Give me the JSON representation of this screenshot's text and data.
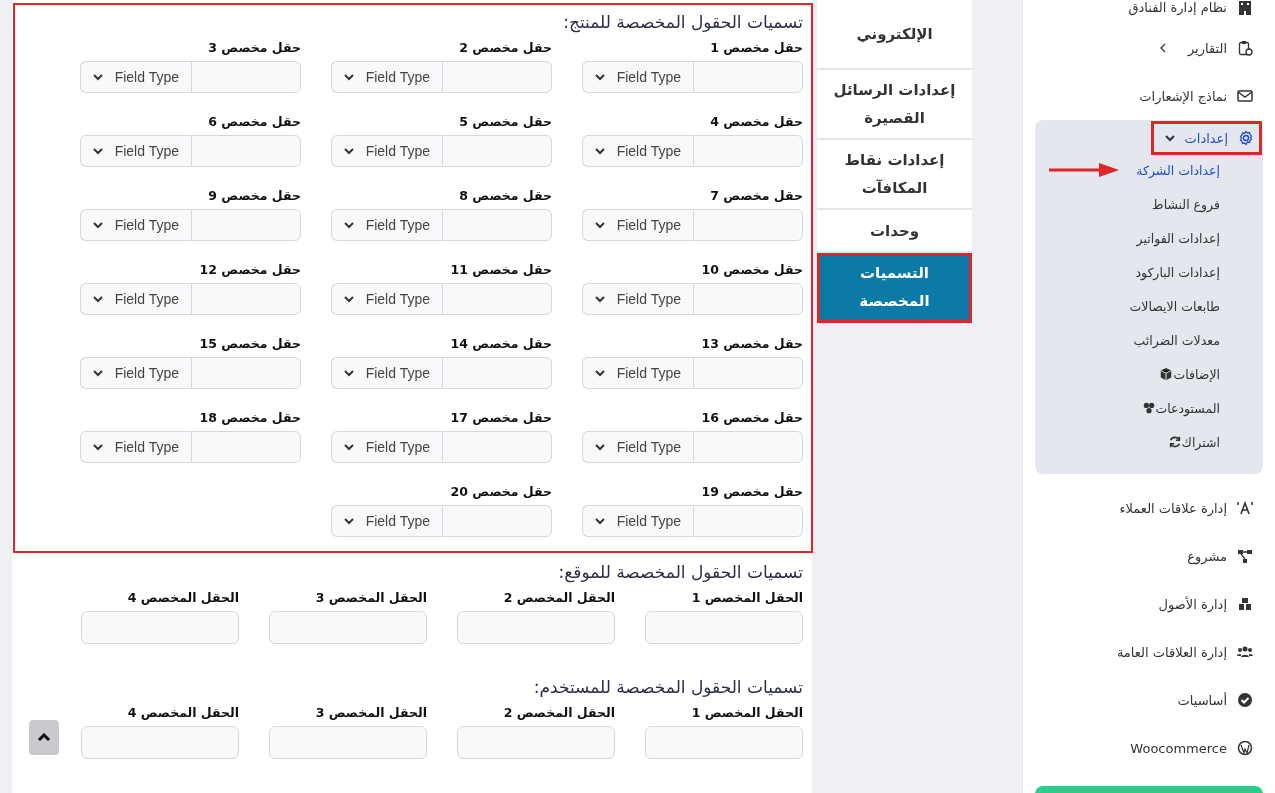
{
  "form": {
    "sections": [
      {
        "kind": "typed",
        "title": "تسميات الحقول المخصصة للمنتج:",
        "highlighted": true,
        "fields": [
          {
            "label": "حقل مخصص 1",
            "type_label": "Field Type"
          },
          {
            "label": "حقل مخصص 2",
            "type_label": "Field Type"
          },
          {
            "label": "حقل مخصص 3",
            "type_label": "Field Type"
          },
          {
            "label": "حقل مخصص 4",
            "type_label": "Field Type"
          },
          {
            "label": "حقل مخصص 5",
            "type_label": "Field Type"
          },
          {
            "label": "حقل مخصص 6",
            "type_label": "Field Type"
          },
          {
            "label": "حقل مخصص 7",
            "type_label": "Field Type"
          },
          {
            "label": "حقل مخصص 8",
            "type_label": "Field Type"
          },
          {
            "label": "حقل مخصص 9",
            "type_label": "Field Type"
          },
          {
            "label": "حقل مخصص 10",
            "type_label": "Field Type"
          },
          {
            "label": "حقل مخصص 11",
            "type_label": "Field Type"
          },
          {
            "label": "حقل مخصص 12",
            "type_label": "Field Type"
          },
          {
            "label": "حقل مخصص 13",
            "type_label": "Field Type"
          },
          {
            "label": "حقل مخصص 14",
            "type_label": "Field Type"
          },
          {
            "label": "حقل مخصص 15",
            "type_label": "Field Type"
          },
          {
            "label": "حقل مخصص 16",
            "type_label": "Field Type"
          },
          {
            "label": "حقل مخصص 17",
            "type_label": "Field Type"
          },
          {
            "label": "حقل مخصص 18",
            "type_label": "Field Type"
          },
          {
            "label": "حقل مخصص 19",
            "type_label": "Field Type"
          },
          {
            "label": "حقل مخصص 20",
            "type_label": "Field Type"
          }
        ]
      },
      {
        "kind": "plain",
        "title": "تسميات الحقول المخصصة للموقع:",
        "highlighted": false,
        "fields": [
          {
            "label": "الحقل المخصص 1"
          },
          {
            "label": "الحقل المخصص 2"
          },
          {
            "label": "الحقل المخصص 3"
          },
          {
            "label": "الحقل المخصص 4"
          }
        ]
      },
      {
        "kind": "plain",
        "title": "تسميات الحقول المخصصة للمستخدم:",
        "highlighted": false,
        "fields": [
          {
            "label": "الحقل المخصص 1"
          },
          {
            "label": "الحقل المخصص 2"
          },
          {
            "label": "الحقل المخصص 3"
          },
          {
            "label": "الحقل المخصص 4"
          }
        ]
      }
    ]
  },
  "tabs": [
    {
      "label": "الإلكتروني",
      "selected": false,
      "highlighted": false
    },
    {
      "label": "إعدادات الرسائل القصيرة",
      "selected": false,
      "highlighted": false
    },
    {
      "label": "إعدادات نقاط المكافآت",
      "selected": false,
      "highlighted": false
    },
    {
      "label": "وحدات",
      "selected": false,
      "highlighted": false
    },
    {
      "label": "التسميات المخصصة",
      "selected": true,
      "highlighted": true
    }
  ],
  "sidebar": {
    "items": [
      {
        "kind": "link",
        "label": "نظام إدارة الفنادق",
        "selected": false
      },
      {
        "kind": "submenu",
        "label": "التقارير",
        "selected": false,
        "expanded": false
      },
      {
        "kind": "link",
        "label": "نماذج الإشعارات",
        "selected": false
      },
      {
        "kind": "submenu",
        "label": "إعدادات",
        "selected": true,
        "expanded": true,
        "highlighted": true,
        "children": [
          {
            "label": "إعدادات الشركة",
            "selected": true,
            "pointed": true
          },
          {
            "label": "فروع النشاط",
            "selected": false,
            "pointed": false
          },
          {
            "label": "إعدادات الفواتير",
            "selected": false,
            "pointed": false
          },
          {
            "label": "إعدادات الباركود",
            "selected": false,
            "pointed": false
          },
          {
            "label": "طابعات الايصالات",
            "selected": false,
            "pointed": false
          },
          {
            "label": "معدلات الضرائب",
            "selected": false,
            "pointed": false
          },
          {
            "label": "الإضافات",
            "selected": false,
            "pointed": false
          },
          {
            "label": "المستودعات",
            "selected": false,
            "pointed": false
          },
          {
            "label": "اشتراك",
            "selected": false,
            "pointed": false
          }
        ]
      },
      {
        "kind": "link",
        "label": "إدارة علاقات العملاء",
        "selected": false
      },
      {
        "kind": "link",
        "label": "مشروع",
        "selected": false
      },
      {
        "kind": "link",
        "label": "إدارة الأصول",
        "selected": false
      },
      {
        "kind": "link",
        "label": "إدارة العلاقات العامة",
        "selected": false
      },
      {
        "kind": "link",
        "label": "أساسيات",
        "selected": false
      },
      {
        "kind": "link",
        "label": "Woocommerce",
        "selected": false
      }
    ]
  }
}
